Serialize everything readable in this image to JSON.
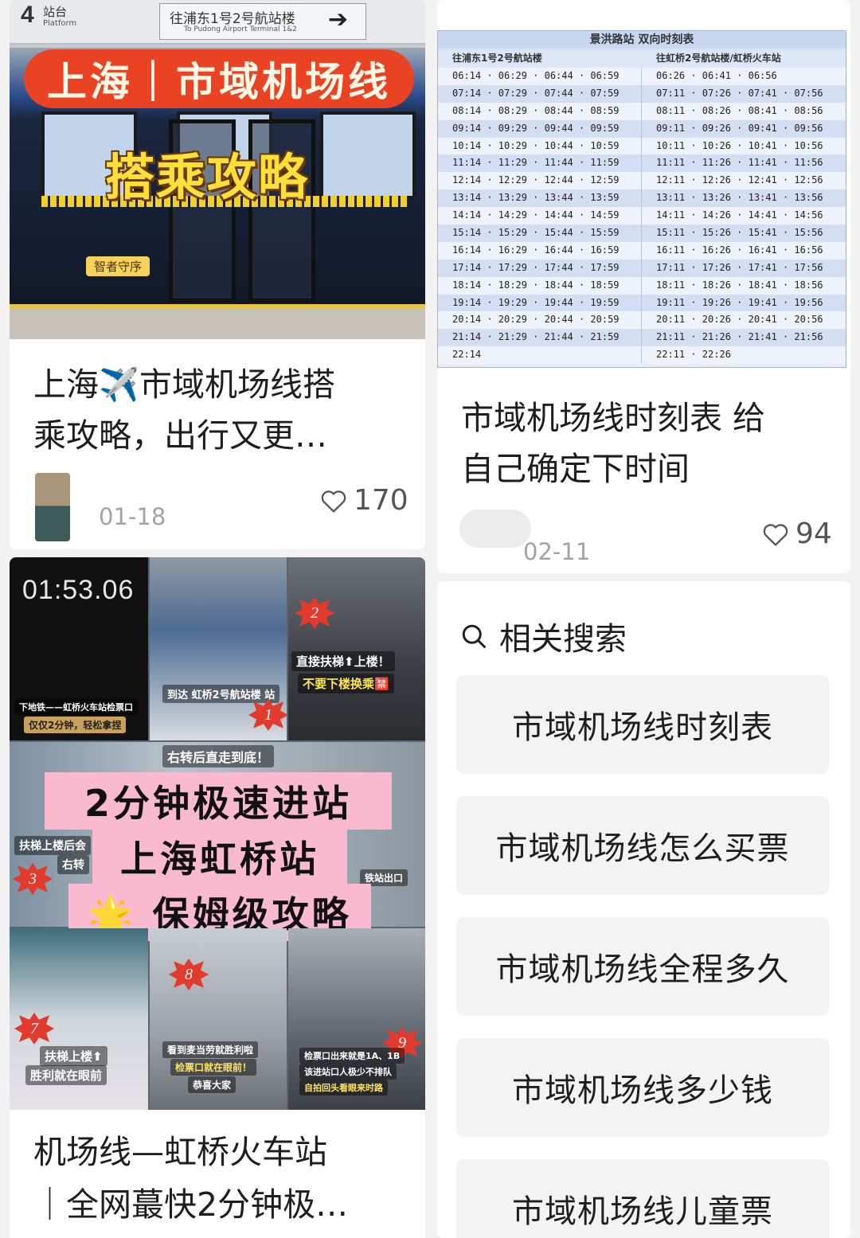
{
  "card1": {
    "cover": {
      "sign_platform_number": "4",
      "sign_platform_cn": "站台",
      "sign_platform_en": "Platform",
      "sign_direction_cn": "往浦东1号2号航站楼",
      "sign_direction_en": "To Pudong Airport Terminal 1&2",
      "headline": "上海｜市域机场线",
      "subheadline": "搭乘攻略",
      "mascot_label": "智者守序"
    },
    "title_line1": "上海✈️市域机场线搭",
    "title_line2": "乘攻略，出行又更…",
    "date": "01-18",
    "likes": "170"
  },
  "card2": {
    "timetable": {
      "title": "景洪路站 双向时刻表",
      "left_header": "往浦东1号2号航站楼",
      "right_header": "往虹桥2号航站楼/虹桥火车站",
      "rows": [
        {
          "left": "06:14 · 06:29 · 06:44 · 06:59",
          "right": "06:26 · 06:41 · 06:56"
        },
        {
          "left": "07:14 · 07:29 · 07:44 · 07:59",
          "right": "07:11 · 07:26 · 07:41 · 07:56"
        },
        {
          "left": "08:14 · 08:29 · 08:44 · 08:59",
          "right": "08:11 · 08:26 · 08:41 · 08:56"
        },
        {
          "left": "09:14 · 09:29 · 09:44 · 09:59",
          "right": "09:11 · 09:26 · 09:41 · 09:56"
        },
        {
          "left": "10:14 · 10:29 · 10:44 · 10:59",
          "right": "10:11 · 10:26 · 10:41 · 10:56"
        },
        {
          "left": "11:14 · 11:29 · 11:44 · 11:59",
          "right": "11:11 · 11:26 · 11:41 · 11:56"
        },
        {
          "left": "12:14 · 12:29 · 12:44 · 12:59",
          "right": "12:11 · 12:26 · 12:41 · 12:56"
        },
        {
          "left": "13:14 · 13:29 · 13:44 · 13:59",
          "right": "13:11 · 13:26 · 13:41 · 13:56"
        },
        {
          "left": "14:14 · 14:29 · 14:44 · 14:59",
          "right": "14:11 · 14:26 · 14:41 · 14:56"
        },
        {
          "left": "15:14 · 15:29 · 15:44 · 15:59",
          "right": "15:11 · 15:26 · 15:41 · 15:56"
        },
        {
          "left": "16:14 · 16:29 · 16:44 · 16:59",
          "right": "16:11 · 16:26 · 16:41 · 16:56"
        },
        {
          "left": "17:14 · 17:29 · 17:44 · 17:59",
          "right": "17:11 · 17:26 · 17:41 · 17:56"
        },
        {
          "left": "18:14 · 18:29 · 18:44 · 18:59",
          "right": "18:11 · 18:26 · 18:41 · 18:56"
        },
        {
          "left": "19:14 · 19:29 · 19:44 · 19:59",
          "right": "19:11 · 19:26 · 19:41 · 19:56"
        },
        {
          "left": "20:14 · 20:29 · 20:44 · 20:59",
          "right": "20:11 · 20:26 · 20:41 · 20:56"
        },
        {
          "left": "21:14 · 21:29 · 21:44 · 21:59",
          "right": "21:11 · 21:26 · 21:41 · 21:56"
        },
        {
          "left": "22:14",
          "right": "22:11 · 22:26"
        }
      ]
    },
    "title_line1": "市域机场线时刻表 给",
    "title_line2": "自己确定下时间",
    "date": "02-11",
    "likes": "94"
  },
  "card3": {
    "cover": {
      "timer": "01:53.06",
      "cap_a": "下地铁——虹桥火车站检票口",
      "cap_a2": "仅仅2分钟，轻松拿捏",
      "cap_b": "到达 虹桥2号航站楼 站",
      "cap_c1": "直接扶梯⬆上楼！",
      "cap_c2": "不要下楼换乘🈲",
      "cap_d": "右转后直走到底！",
      "cap_e": "扶梯上楼后会",
      "cap_e2": "右转",
      "cap_f": "铁站出口",
      "cap_g1": "扶梯上楼⬆",
      "cap_g2": "胜利就在眼前",
      "cap_h1": "看到麦当劳就胜利啦",
      "cap_h2": "检票口就在眼前！",
      "cap_h3": "恭喜大家",
      "cap_i1": "检票口出来就是1A、1B",
      "cap_i2": "该进站口人极少不排队",
      "cap_i3": "自拍回头看眼来时路",
      "badges": [
        "1",
        "2",
        "3",
        "7",
        "8",
        "9"
      ],
      "pink1": "2分钟极速进站",
      "pink2": "上海虹桥站",
      "pink3": "🌟 保姆级攻略"
    },
    "title_line1": "机场线—虹桥火车站",
    "title_line2": "｜全网蕞快2分钟极…"
  },
  "related": {
    "heading": "相关搜索",
    "items": [
      "市域机场线时刻表",
      "市域机场线怎么买票",
      "市域机场线全程多久",
      "市域机场线多少钱",
      "市域机场线儿童票"
    ]
  },
  "colors": {
    "accent_red": "#ea4324",
    "title_yellow": "#ffe03a",
    "pink_banner": "#f9b9cf",
    "timetable_blue": "#c9d8f0"
  },
  "icons": [
    "heart-icon",
    "search-icon",
    "airplane-emoji",
    "star-emoji"
  ]
}
